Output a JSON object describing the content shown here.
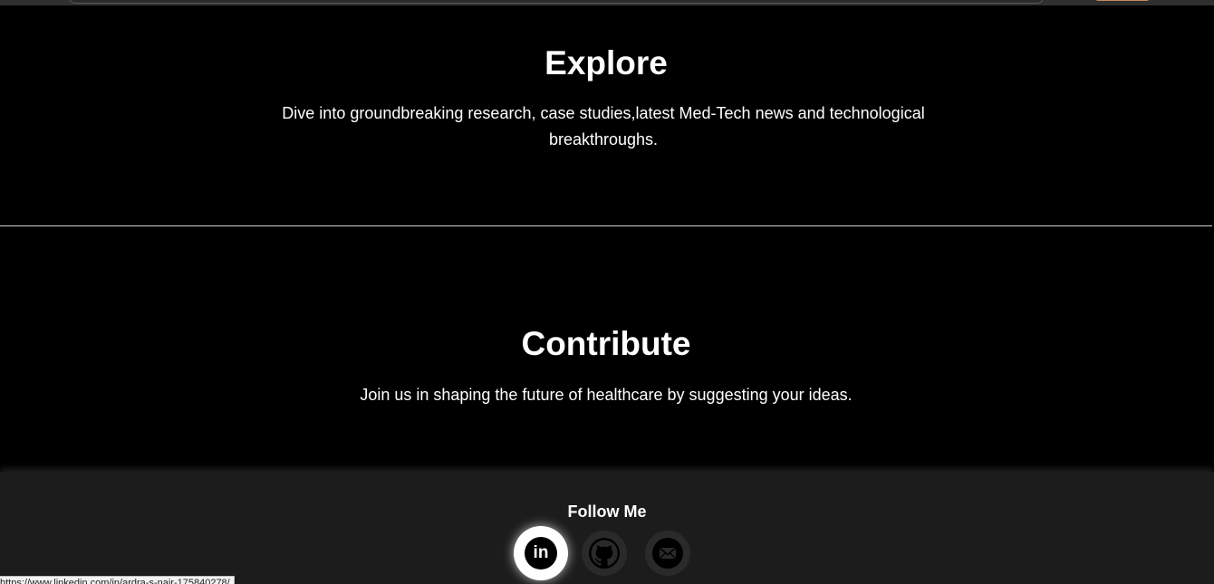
{
  "explore": {
    "title": "Explore",
    "description": "Dive into groundbreaking research, case studies,latest Med-Tech news and technological breakthroughs."
  },
  "contribute": {
    "title": "Contribute",
    "description": "Join us in shaping the future of healthcare by suggesting your ideas."
  },
  "footer": {
    "heading": "Follow Me",
    "socials": [
      {
        "name": "linkedin-icon",
        "glyph": "in"
      },
      {
        "name": "github-icon"
      },
      {
        "name": "mail-icon"
      }
    ]
  },
  "status_bar": {
    "url": "https://www.linkedin.com/in/ardra-s-nair-175840278/"
  },
  "colors": {
    "background": "#000000",
    "footer_bg": "#1c1c1c",
    "text": "#ffffff",
    "icon_bg": "#2a2a2a"
  }
}
